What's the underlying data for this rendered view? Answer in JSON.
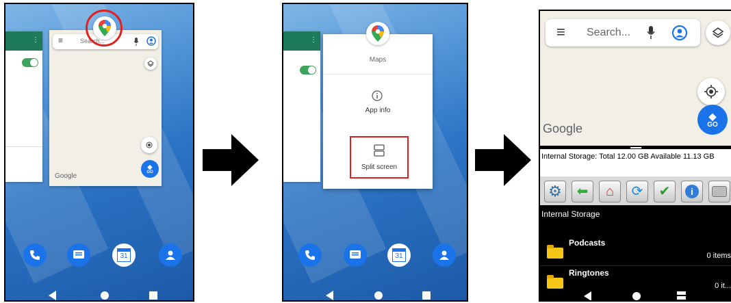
{
  "panel1": {
    "search_placeholder": "Search...",
    "google_logo": "Google",
    "go_label": "GO",
    "calendar_day": "31"
  },
  "panel2": {
    "app_name": "Maps",
    "app_info_label": "App info",
    "split_screen_label": "Split screen",
    "calendar_day": "31"
  },
  "panel3": {
    "search_placeholder": "Search...",
    "google_logo": "Google",
    "go_label": "GO",
    "storage_info": "Internal Storage: Total 12.00 GB   Available 11.13 GB",
    "location_label": "Internal Storage",
    "folders": [
      {
        "name": "Podcasts",
        "count": "0 items"
      },
      {
        "name": "Ringtones",
        "count": "0 it..."
      }
    ]
  },
  "colors": {
    "highlight_red": "#e0201f",
    "maps_blue": "#1a73e8",
    "toggle_green": "#3fa45b"
  },
  "icons": {
    "phone": "phone-icon",
    "messages": "messages-icon",
    "calendar": "calendar-icon",
    "contacts": "contacts-icon"
  }
}
